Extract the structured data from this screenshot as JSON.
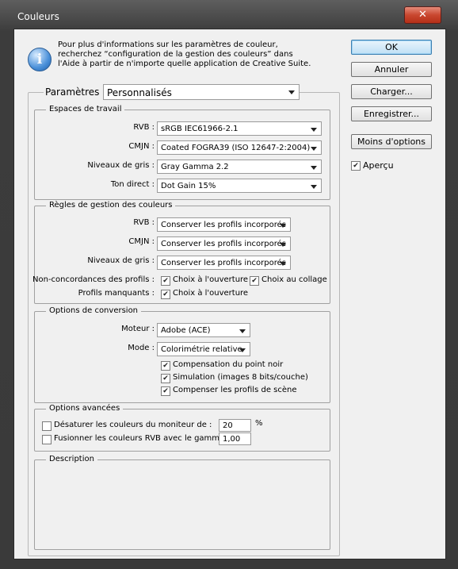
{
  "window": {
    "title": "Couleurs"
  },
  "info": {
    "text": "Pour plus d'informations sur les paramètres de couleur, recherchez “configuration de la gestion des couleurs” dans l'Aide à partir de n'importe quelle application de Creative Suite."
  },
  "buttons": {
    "ok": "OK",
    "cancel": "Annuler",
    "load": "Charger...",
    "save": "Enregistrer...",
    "fewer_options": "Moins d'options"
  },
  "preview": {
    "label": "Aperçu",
    "checked": true
  },
  "settings": {
    "label": "Paramètres :",
    "value": "Personnalisés"
  },
  "working_spaces": {
    "title": "Espaces de travail",
    "rgb": {
      "label": "RVB :",
      "value": "sRGB IEC61966-2.1"
    },
    "cmyk": {
      "label": "CMJN :",
      "value": "Coated FOGRA39 (ISO 12647-2:2004)"
    },
    "gray": {
      "label": "Niveaux de gris :",
      "value": "Gray Gamma 2.2"
    },
    "spot": {
      "label": "Ton direct :",
      "value": "Dot Gain 15%"
    }
  },
  "policies": {
    "title": "Règles de gestion des couleurs",
    "rgb": {
      "label": "RVB :",
      "value": "Conserver les profils incorporés"
    },
    "cmyk": {
      "label": "CMJN :",
      "value": "Conserver les profils incorporés"
    },
    "gray": {
      "label": "Niveaux de gris :",
      "value": "Conserver les profils incorporés"
    },
    "mismatch_label": "Non-concordances des profils :",
    "mismatch_open": "Choix à l'ouverture",
    "mismatch_paste": "Choix au collage",
    "missing_label": "Profils manquants :",
    "missing_open": "Choix à l'ouverture"
  },
  "conversion": {
    "title": "Options de conversion",
    "engine": {
      "label": "Moteur :",
      "value": "Adobe (ACE)"
    },
    "intent": {
      "label": "Mode :",
      "value": "Colorimétrie relative"
    },
    "bpc": "Compensation du point noir",
    "dither": "Simulation (images 8 bits/couche)",
    "scene": "Compenser les profils de scène"
  },
  "advanced": {
    "title": "Options avancées",
    "desaturate": {
      "label": "Désaturer les couleurs du moniteur de :",
      "value": "20",
      "unit": "%"
    },
    "blend": {
      "label": "Fusionner les couleurs RVB avec le gamma :",
      "value": "1,00"
    }
  },
  "description": {
    "title": "Description"
  }
}
